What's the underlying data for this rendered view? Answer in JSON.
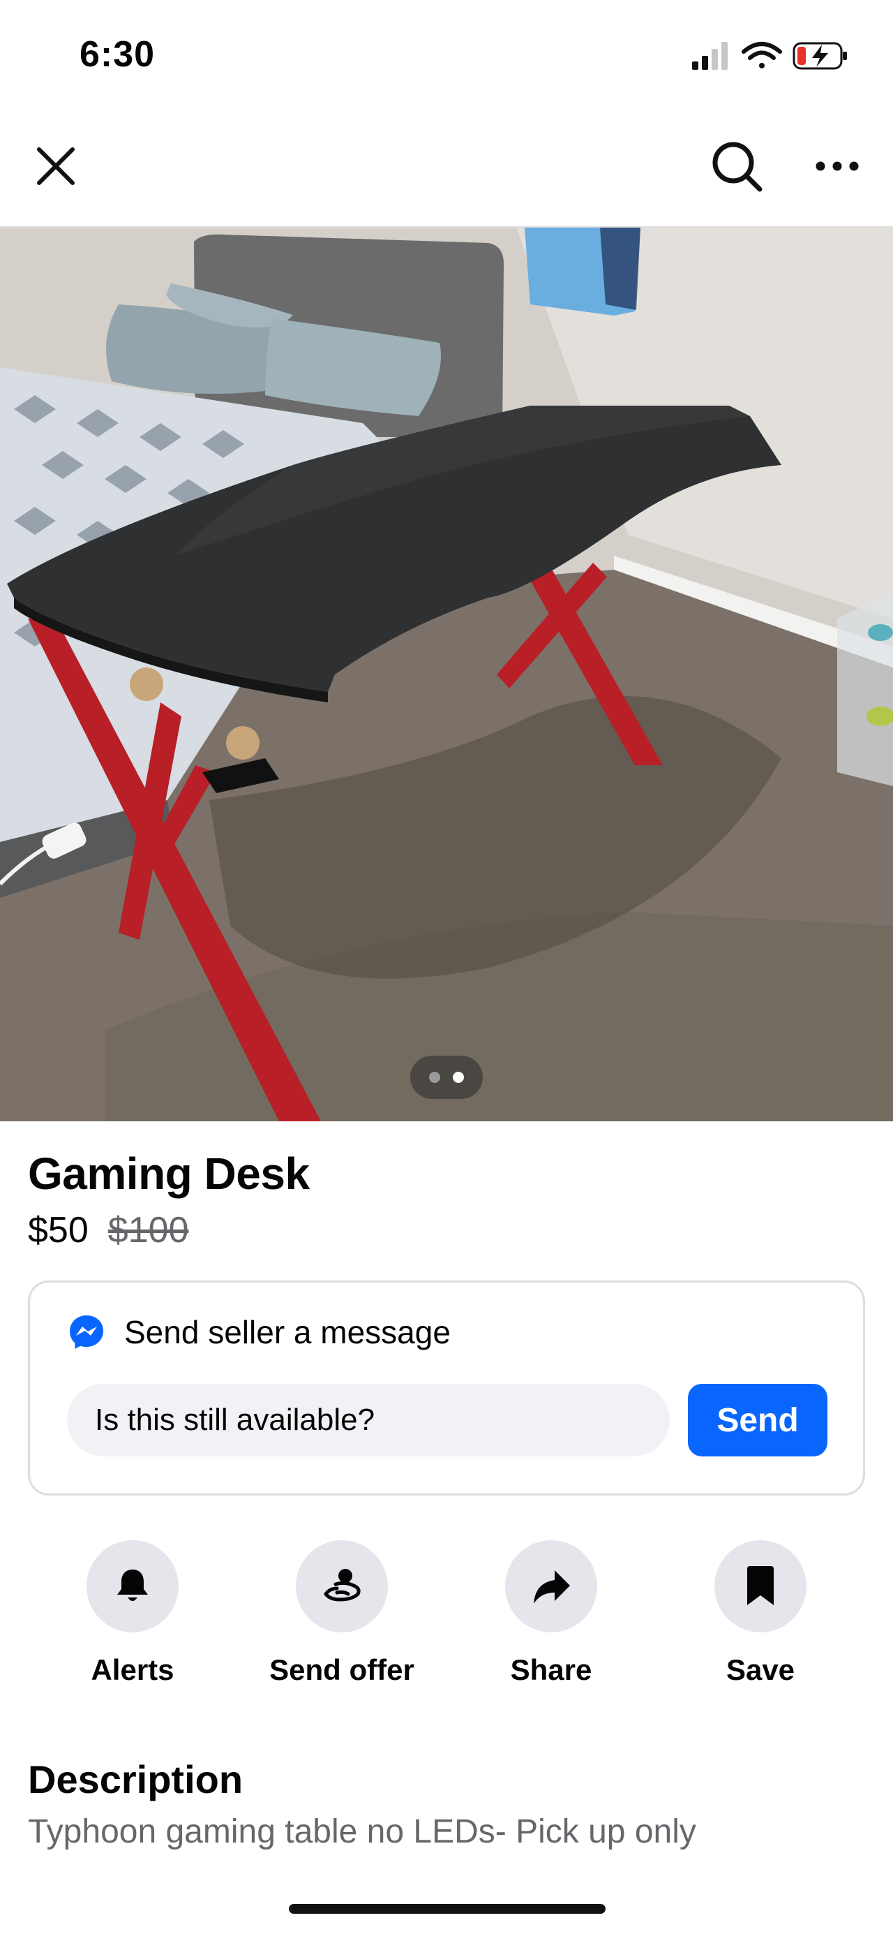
{
  "status_bar": {
    "time": "6:30"
  },
  "nav": {
    "close_icon": "close-icon",
    "search_icon": "search-icon",
    "more_icon": "more-icon"
  },
  "listing": {
    "photo_count": 2,
    "active_photo_index": 1,
    "title": "Gaming Desk",
    "price": "$50",
    "original_price": "$100"
  },
  "message": {
    "heading": "Send seller a message",
    "input_value": "Is this still available?",
    "send_label": "Send"
  },
  "actions": [
    {
      "label": "Alerts",
      "icon": "bell-icon"
    },
    {
      "label": "Send offer",
      "icon": "offer-icon"
    },
    {
      "label": "Share",
      "icon": "share-icon"
    },
    {
      "label": "Save",
      "icon": "bookmark-icon"
    }
  ],
  "description": {
    "heading": "Description",
    "text": "Typhoon gaming table no LEDs- Pick up only"
  },
  "colors": {
    "accent": "#0866ff",
    "secondary_text": "#65676b",
    "action_bg": "#e4e6eb",
    "input_bg": "#f0f2f5"
  }
}
